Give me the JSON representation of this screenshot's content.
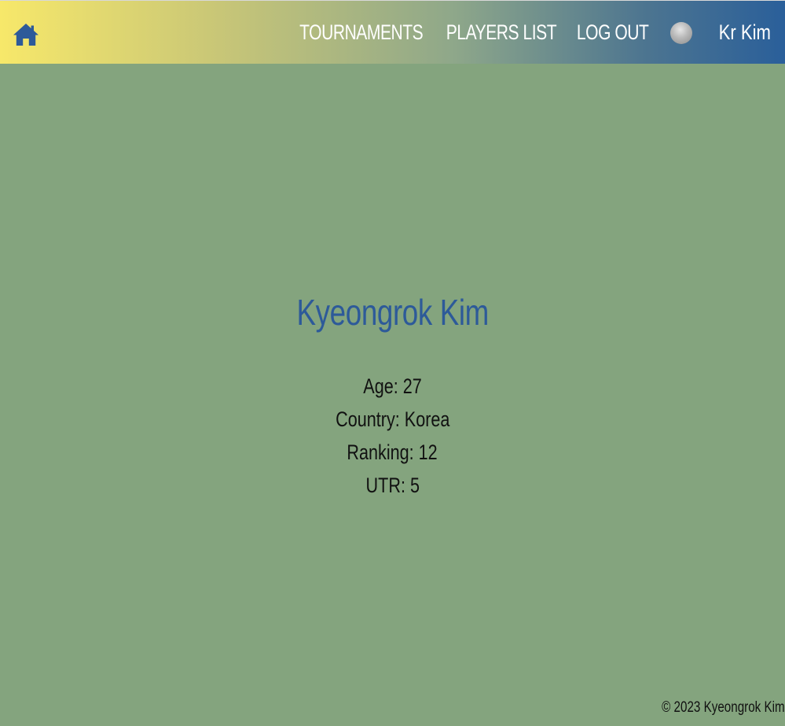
{
  "navbar": {
    "home_icon": "home-icon",
    "links": {
      "tournaments": "TOURNAMENTS",
      "players_list": "PLAYERS LIST",
      "log_out": "LOG OUT"
    },
    "avatar_icon": "user-avatar",
    "user_name": "Kr Kim",
    "gradient_colors": [
      "#f7e86a",
      "#c8c677",
      "#8ea78a",
      "#4d7590",
      "#2a5f9a"
    ]
  },
  "profile": {
    "name": "Kyeongrok Kim",
    "age": "Age: 27",
    "country": "Country: Korea",
    "ranking": "Ranking: 12",
    "utr": "UTR: 5"
  },
  "footer": {
    "copyright": "© 2023 Kyeongrok Kim"
  },
  "colors": {
    "background": "#84a47e",
    "name_text": "#2d5a99",
    "home_icon": "#2d5a99"
  }
}
